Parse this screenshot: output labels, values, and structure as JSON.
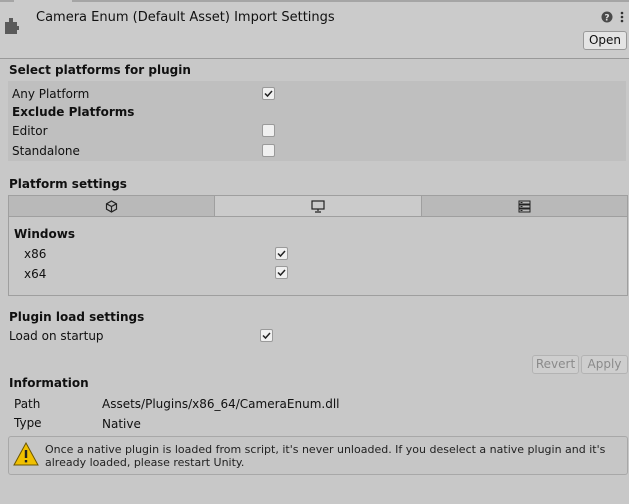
{
  "header": {
    "title": "Camera Enum (Default Asset) Import Settings",
    "open_label": "Open",
    "help_icon": "help-icon",
    "menu_icon": "kebab-menu-icon"
  },
  "platforms": {
    "title": "Select platforms for plugin",
    "any_platform": {
      "label": "Any Platform",
      "checked": true
    },
    "exclude_title": "Exclude Platforms",
    "editor": {
      "label": "Editor",
      "checked": false
    },
    "standalone": {
      "label": "Standalone",
      "checked": false
    }
  },
  "platform_settings": {
    "title": "Platform settings",
    "tabs": [
      {
        "icon": "unity-editor-icon",
        "active": false
      },
      {
        "icon": "desktop-monitor-icon",
        "active": true
      },
      {
        "icon": "server-icon",
        "active": false
      }
    ],
    "windows_title": "Windows",
    "x86": {
      "label": "x86",
      "checked": true
    },
    "x64": {
      "label": "x64",
      "checked": true
    }
  },
  "load": {
    "title": "Plugin load settings",
    "startup": {
      "label": "Load on startup",
      "checked": true
    },
    "revert_label": "Revert",
    "apply_label": "Apply"
  },
  "information": {
    "title": "Information",
    "path_label": "Path",
    "path_value": "Assets/Plugins/x86_64/CameraEnum.dll",
    "type_label": "Type",
    "type_value": "Native",
    "warning": "Once a native plugin is loaded from script, it's never unloaded. If you deselect a native plugin and it's already loaded, please restart Unity."
  },
  "colors": {
    "background": "#c8c8c8",
    "header": "#cbcbcb",
    "warning": "#f0c000"
  }
}
